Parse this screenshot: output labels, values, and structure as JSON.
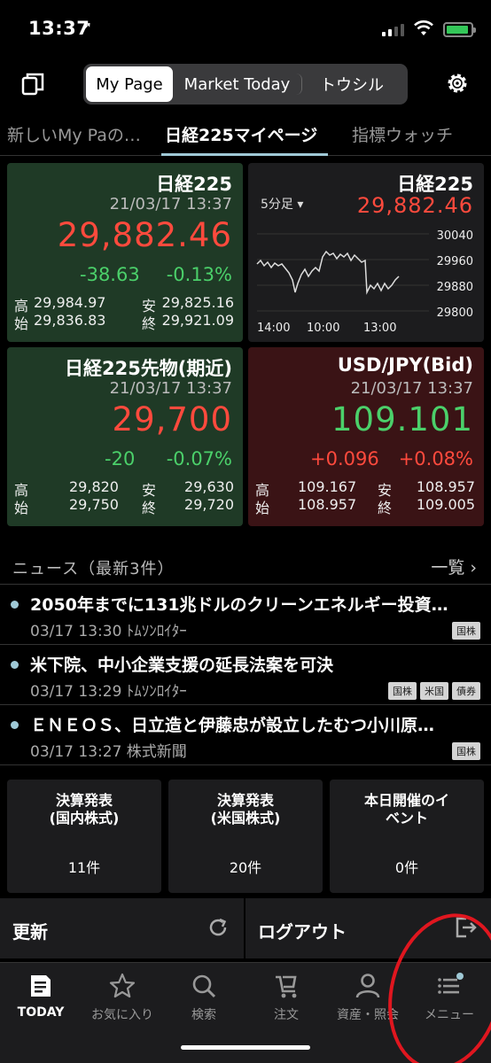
{
  "status_bar": {
    "time": "13:37",
    "location_glyph": "➚"
  },
  "header": {
    "segments": [
      "My Page",
      "Market Today",
      "トウシル"
    ]
  },
  "page_tabs": [
    "新しいMy Paの…",
    "日経225マイページ",
    "指標ウォッチ"
  ],
  "cards": {
    "nikkei": {
      "name": "日経225",
      "timestamp": "21/03/17 13:37",
      "price": "29,882.46",
      "change": "-38.63",
      "change_pct": "-0.13%",
      "high_label": "高",
      "high": "29,984.97",
      "low_label": "安",
      "low": "29,825.16",
      "open_label": "始",
      "open": "29,836.83",
      "close_label": "終",
      "close": "29,921.09"
    },
    "chart": {
      "name": "日経225",
      "interval": "5分足 ▾",
      "price": "29,882.46",
      "y_ticks": [
        "30040",
        "29960",
        "29880",
        "29800"
      ],
      "x_ticks": [
        "14:00",
        "10:00",
        "13:00"
      ]
    },
    "futures": {
      "name": "日経225先物(期近)",
      "timestamp": "21/03/17 13:37",
      "price": "29,700",
      "change": "-20",
      "change_pct": "-0.07%",
      "high_label": "高",
      "high": "29,820",
      "low_label": "安",
      "low": "29,630",
      "open_label": "始",
      "open": "29,750",
      "close_label": "終",
      "close": "29,720"
    },
    "usdjpy": {
      "name": "USD/JPY(Bid)",
      "timestamp": "21/03/17 13:37",
      "price": "109.101",
      "change": "+0.096",
      "change_pct": "+0.08%",
      "high_label": "高",
      "high": "109.167",
      "low_label": "安",
      "low": "108.957",
      "open_label": "始",
      "open": "108.957",
      "close_label": "終",
      "close": "109.005"
    }
  },
  "news": {
    "title": "ニュース（最新3件）",
    "more": "一覧 ›",
    "items": [
      {
        "title": "2050年までに131兆ドルのクリーンエネルギー投資…",
        "meta": "03/17 13:30 ﾄﾑｿﾝﾛｲﾀｰ",
        "tags": [
          "国株"
        ]
      },
      {
        "title": "米下院、中小企業支援の延長法案を可決",
        "meta": "03/17 13:29 ﾄﾑｿﾝﾛｲﾀｰ",
        "tags": [
          "国株",
          "米国",
          "債券"
        ]
      },
      {
        "title": "ＥＮＥＯＳ、日立造と伊藤忠が設立したむつ小川原…",
        "meta": "03/17 13:27 株式新聞",
        "tags": [
          "国株"
        ]
      }
    ]
  },
  "tiles": [
    {
      "label": "決算発表\n(国内株式)",
      "value": "11件"
    },
    {
      "label": "決算発表\n(米国株式)",
      "value": "20件"
    },
    {
      "label": "本日開催のイ\nベント",
      "value": "0件"
    }
  ],
  "actions": {
    "refresh": "更新",
    "logout": "ログアウト"
  },
  "nav": [
    "TODAY",
    "お気に入り",
    "検索",
    "注文",
    "資産・照会",
    "メニュー"
  ],
  "colors": {
    "down": "#4bd06a",
    "up_price": "#ff4a3d",
    "accent": "#9fc9d6",
    "annotation": "#e0161f"
  }
}
